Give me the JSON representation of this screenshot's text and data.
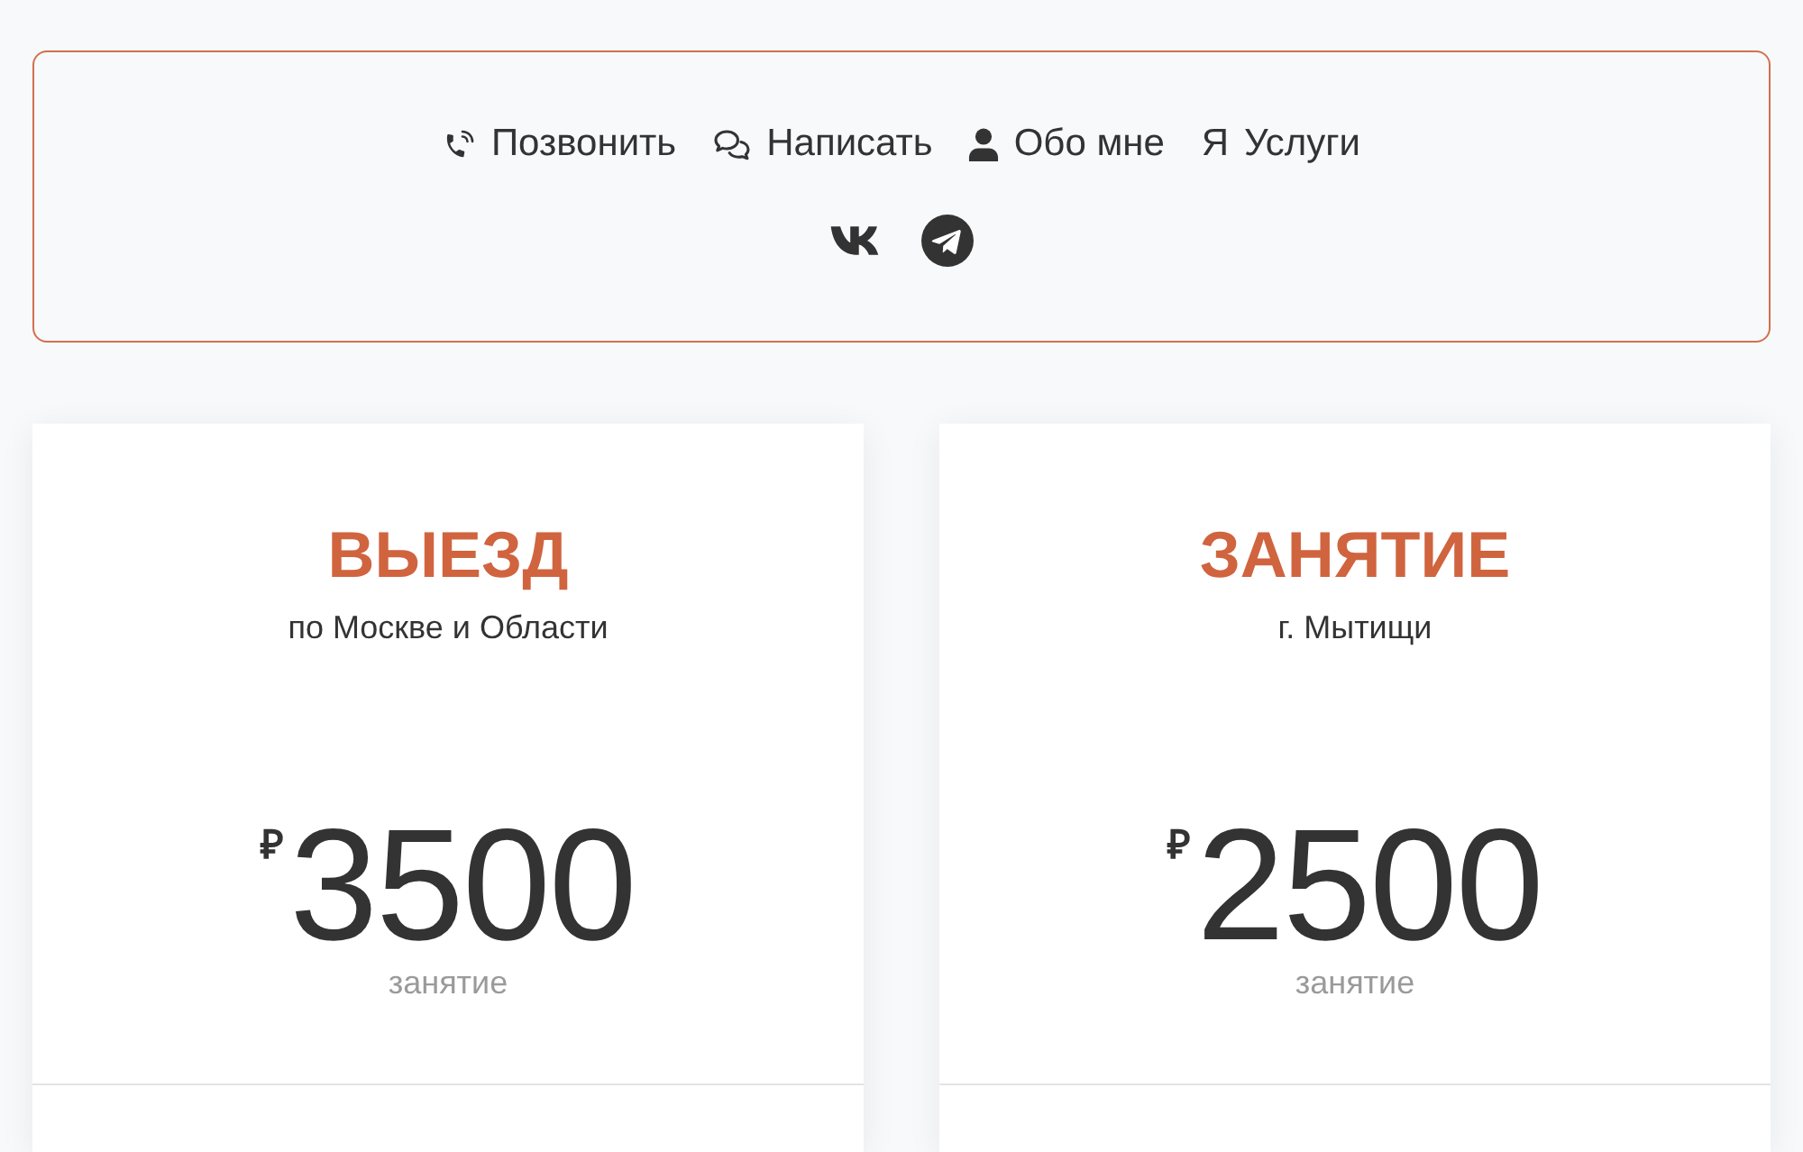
{
  "nav": {
    "links": [
      {
        "kind": "phone",
        "label": "Позвонить"
      },
      {
        "kind": "chat",
        "label": "Написать"
      },
      {
        "kind": "person",
        "label": "Обо мне"
      },
      {
        "kind": "letter",
        "icon": "Я",
        "label": "Услуги"
      }
    ],
    "social": [
      {
        "kind": "vk"
      },
      {
        "kind": "telegram"
      }
    ]
  },
  "cards": [
    {
      "title": "ВЫЕЗД",
      "subtitle": "по Москве и Области",
      "currency": "₽",
      "price": "3500",
      "unit": "занятие"
    },
    {
      "title": "ЗАНЯТИЕ",
      "subtitle": "г. Мытищи",
      "currency": "₽",
      "price": "2500",
      "unit": "занятие"
    }
  ]
}
